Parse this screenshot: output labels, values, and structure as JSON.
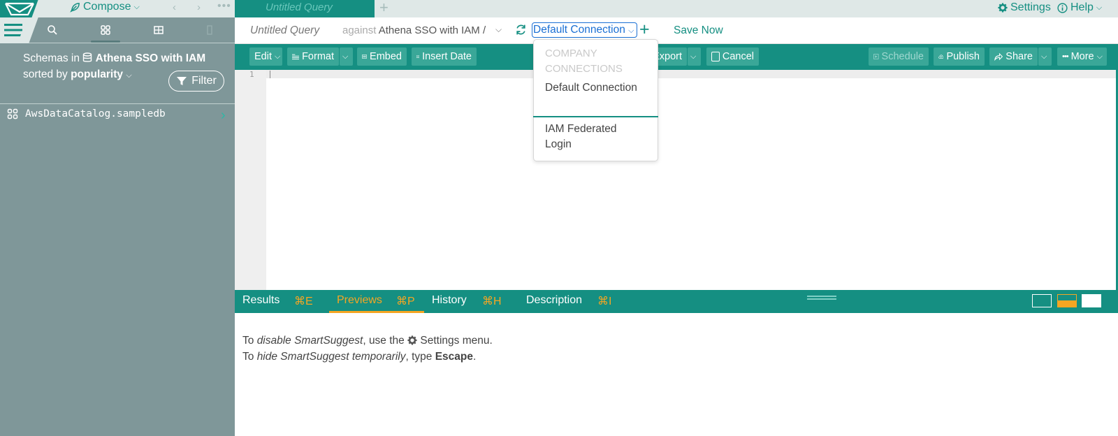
{
  "app": {
    "compose_label": "Compose",
    "settings_label": "Settings",
    "help_label": "Help"
  },
  "tabs": [
    {
      "label": "Untitled Query",
      "active": true
    }
  ],
  "query": {
    "title": "Untitled Query",
    "against_label": "against",
    "data_source": "Athena SSO with IAM",
    "path_sep": "/",
    "connection": "Default Connection",
    "save_label": "Save Now"
  },
  "sidebar": {
    "schemas_prefix": "Schemas in",
    "data_source": "Athena SSO with IAM",
    "sorted_prefix": "sorted by",
    "sort_value": "popularity",
    "filter_label": "Filter",
    "schemas": [
      {
        "name": "AwsDataCatalog.sampledb"
      }
    ]
  },
  "toolbar": {
    "edit": "Edit",
    "format": "Format",
    "embed": "Embed",
    "insert_date": "Insert Date",
    "export": "Export",
    "cancel": "Cancel",
    "schedule": "Schedule",
    "publish": "Publish",
    "share": "Share",
    "more": "More"
  },
  "editor": {
    "line_numbers": [
      "1"
    ]
  },
  "dropdown": {
    "section_label": "COMPANY CONNECTIONS",
    "items": [
      {
        "label": "Default Connection",
        "selected": true
      },
      {
        "label": "IAM Federated Login",
        "selected": false
      }
    ]
  },
  "bottom_tabs": [
    {
      "label": "Results",
      "shortcut": "⌘E",
      "active": false
    },
    {
      "label": "Previews",
      "shortcut": "⌘P",
      "active": true
    },
    {
      "label": "History",
      "shortcut": "⌘H",
      "active": false
    },
    {
      "label": "Description",
      "shortcut": "⌘I",
      "active": false
    }
  ],
  "tips": {
    "line1_pre": "To",
    "line1_em": "disable SmartSuggest",
    "line1_mid": ", use the",
    "line1_post": "Settings menu.",
    "line2_pre": "To",
    "line2_em": "hide SmartSuggest temporarily",
    "line2_mid": ", type",
    "line2_key": "Escape",
    "line2_post": "."
  },
  "colors": {
    "brand": "#158f82",
    "accent": "#f5a623",
    "sidebar_bg": "#7f9799",
    "link_blue": "#1a6fd4"
  }
}
